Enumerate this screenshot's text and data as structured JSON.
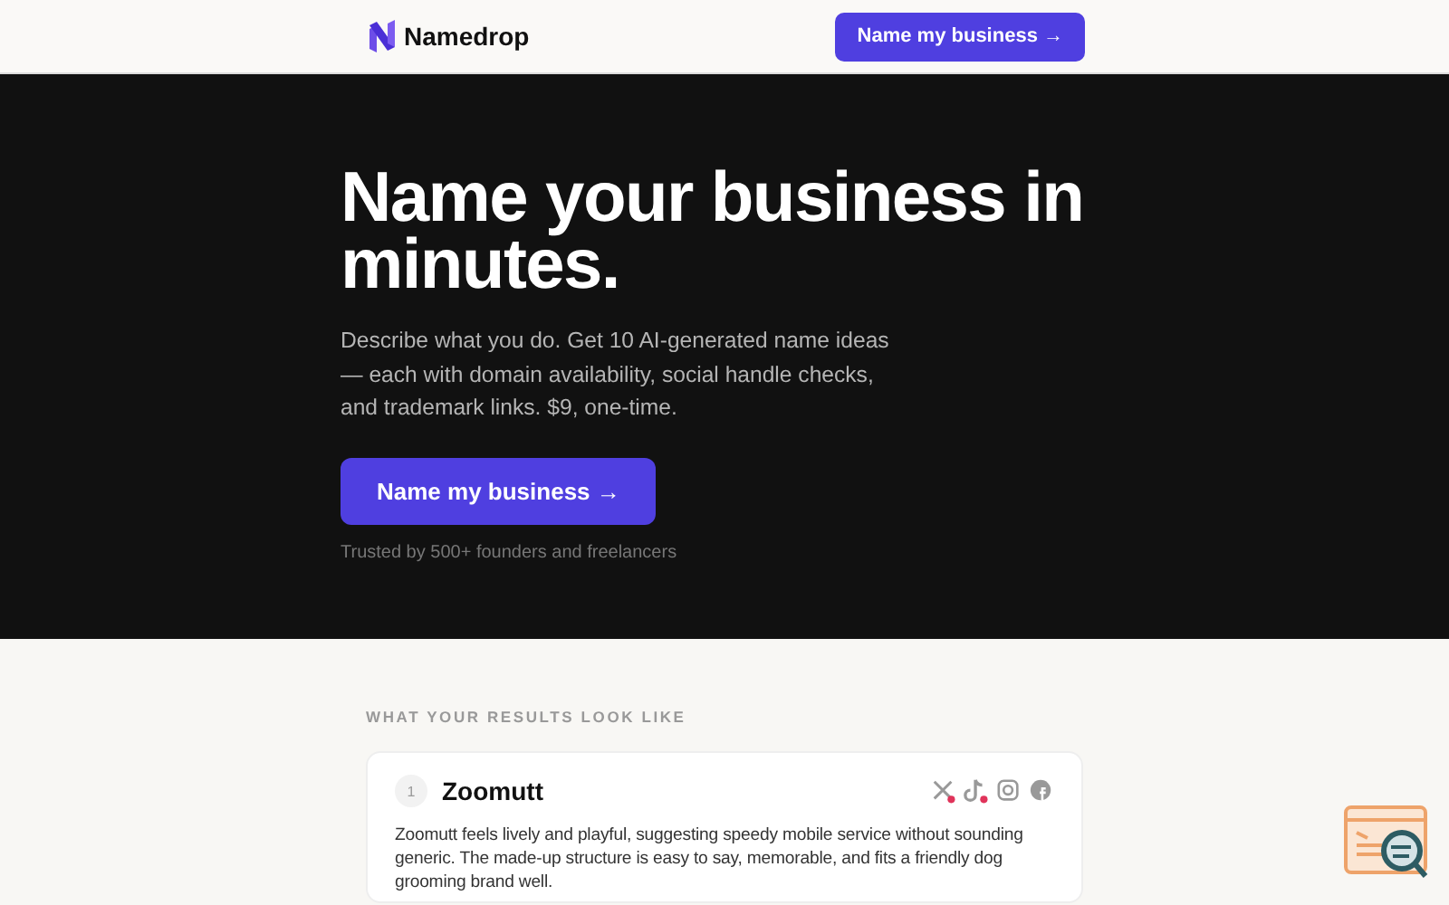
{
  "header": {
    "brand": "Namedrop",
    "cta": "Name my business →"
  },
  "hero": {
    "headline": "Name your business in minutes.",
    "description": "Describe what you do. Get 10 AI-generated name ideas — each with domain availability, social handle checks, and trademark links. $9, one-time.",
    "cta": "Name my business →",
    "trust": "Trusted by 500+ founders and freelancers"
  },
  "results": {
    "heading": "WHAT YOUR RESULTS LOOK LIKE",
    "cards": [
      {
        "rank": "1",
        "name": "Zoomutt",
        "description": "Zoomutt feels lively and playful, suggesting speedy mobile service without sounding generic. The made-up structure is easy to say, memorable, and fits a friendly dog grooming brand well.",
        "socials": [
          {
            "kind": "x",
            "taken": true
          },
          {
            "kind": "tiktok",
            "taken": true
          },
          {
            "kind": "instagram",
            "taken": false
          },
          {
            "kind": "facebook",
            "taken": false
          }
        ]
      }
    ]
  }
}
